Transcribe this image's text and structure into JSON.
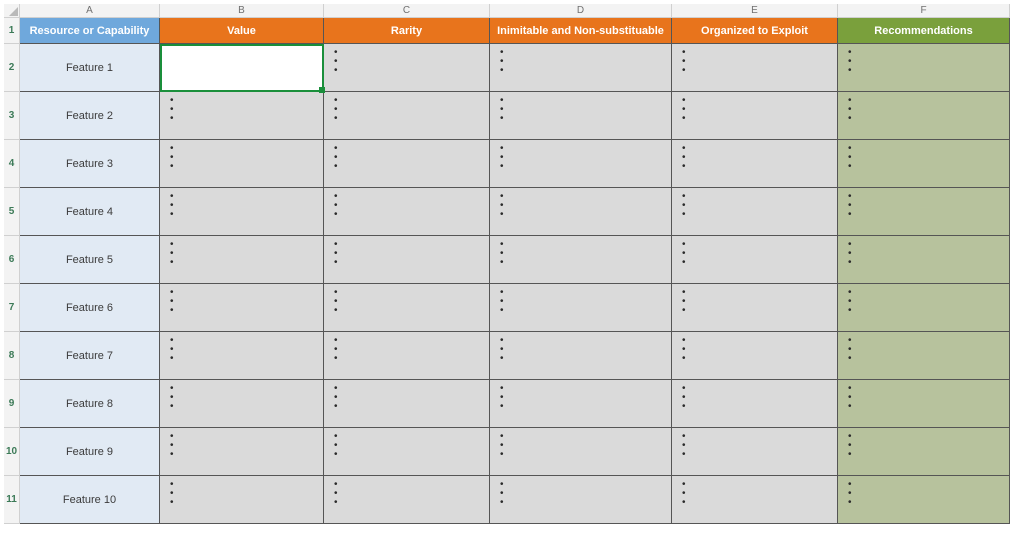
{
  "columns": [
    "A",
    "B",
    "C",
    "D",
    "E",
    "F"
  ],
  "rowNumbers": [
    "1",
    "2",
    "3",
    "4",
    "5",
    "6",
    "7",
    "8",
    "9",
    "10",
    "11"
  ],
  "header": {
    "A": "Resource or Capability",
    "B": "Value",
    "C": "Rarity",
    "D": "Inimitable and Non-substituable",
    "E": "Organized to Exploit",
    "F": "Recommendations"
  },
  "features": [
    "Feature 1",
    "Feature 2",
    "Feature 3",
    "Feature 4",
    "Feature 5",
    "Feature 6",
    "Feature 7",
    "Feature 8",
    "Feature 9",
    "Feature 10"
  ],
  "activeCell": "B2"
}
